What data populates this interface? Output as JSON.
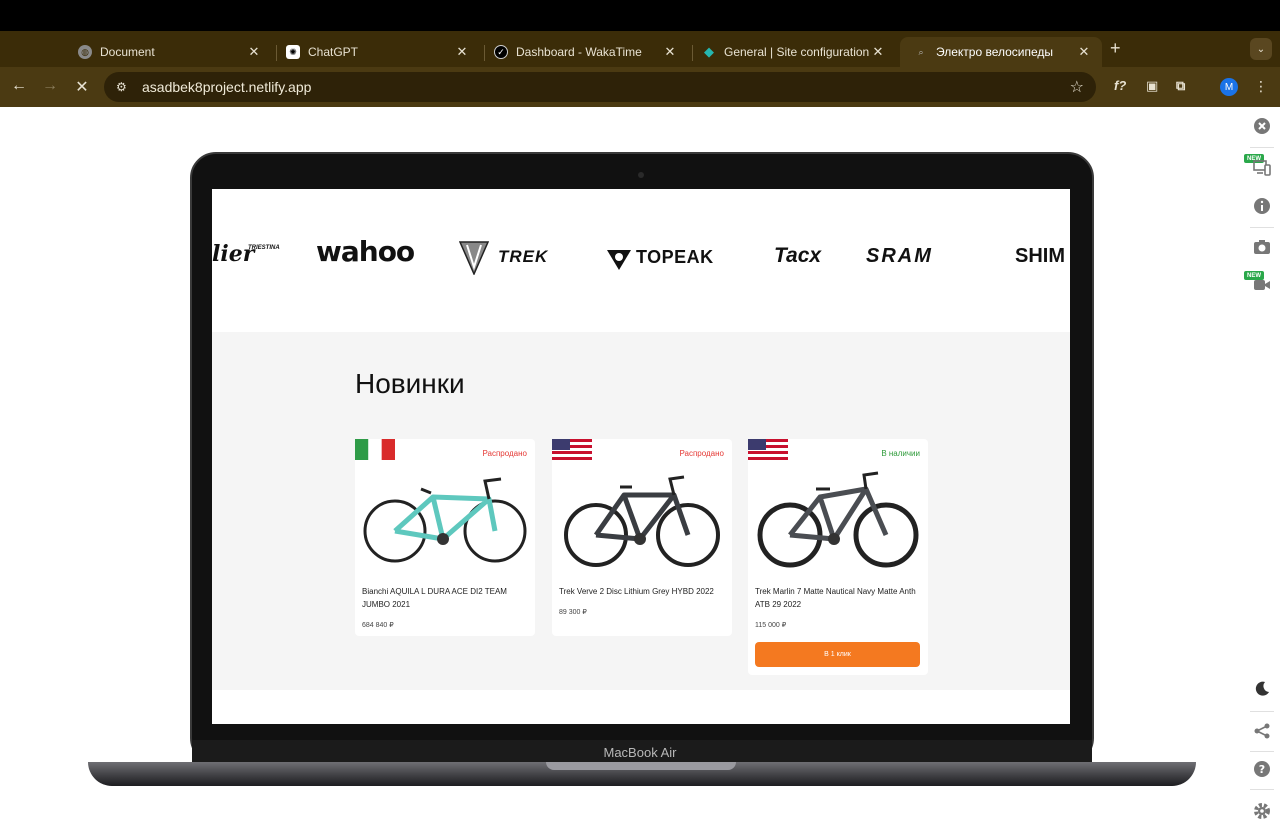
{
  "browser": {
    "tabs": [
      {
        "title": "Document",
        "icon": "globe-icon"
      },
      {
        "title": "ChatGPT",
        "icon": "chatgpt-icon"
      },
      {
        "title": "Dashboard - WakaTime",
        "icon": "wakatime-icon"
      },
      {
        "title": "General | Site configuration | t",
        "icon": "netlify-icon"
      },
      {
        "title": "Электро велосипеды",
        "icon": "site-icon",
        "active": true
      }
    ],
    "new_tab_label": "+",
    "url": "asadbek8project.netlify.app",
    "avatar_initial": "M",
    "extension_label": "f?"
  },
  "side_panel": {
    "new_badge": "NEW",
    "icons": [
      "close-circle-icon",
      "responsive-icon",
      "info-icon",
      "camera-icon",
      "video-icon",
      "moon-icon",
      "share-icon",
      "help-icon",
      "gear-icon"
    ]
  },
  "laptop": {
    "label": "MacBook Air"
  },
  "page": {
    "brands": [
      "lier",
      "wahoo",
      "TREK",
      "TOPEAK",
      "Tacx",
      "SRAM",
      "SHIM"
    ],
    "brand_small": "TRIESTINA",
    "section_title": "Новинки",
    "products": [
      {
        "name": "Bianchi AQUILA L DURA ACE DI2 TEAM JUMBO 2021",
        "price": "684 840 ₽",
        "status": "Распродано",
        "status_color": "#e53935",
        "flag": "italy",
        "frame_color": "#5ec8be"
      },
      {
        "name": "Trek Verve 2 Disc Lithium Grey HYBD 2022",
        "price": "89 300 ₽",
        "status": "Распродано",
        "status_color": "#e53935",
        "flag": "usa",
        "frame_color": "#3a3d42"
      },
      {
        "name": "Trek Marlin 7 Matte Nautical Navy Matte Anth ATB 29 2022",
        "price": "115 000 ₽",
        "status": "В наличии",
        "status_color": "#2e9b3a",
        "flag": "usa",
        "frame_color": "#4a4d52",
        "button": "В 1 клик"
      }
    ]
  },
  "colors": {
    "accent": "#f47920",
    "tabstrip": "#3b2c08",
    "toolbar": "#4b3a12"
  }
}
